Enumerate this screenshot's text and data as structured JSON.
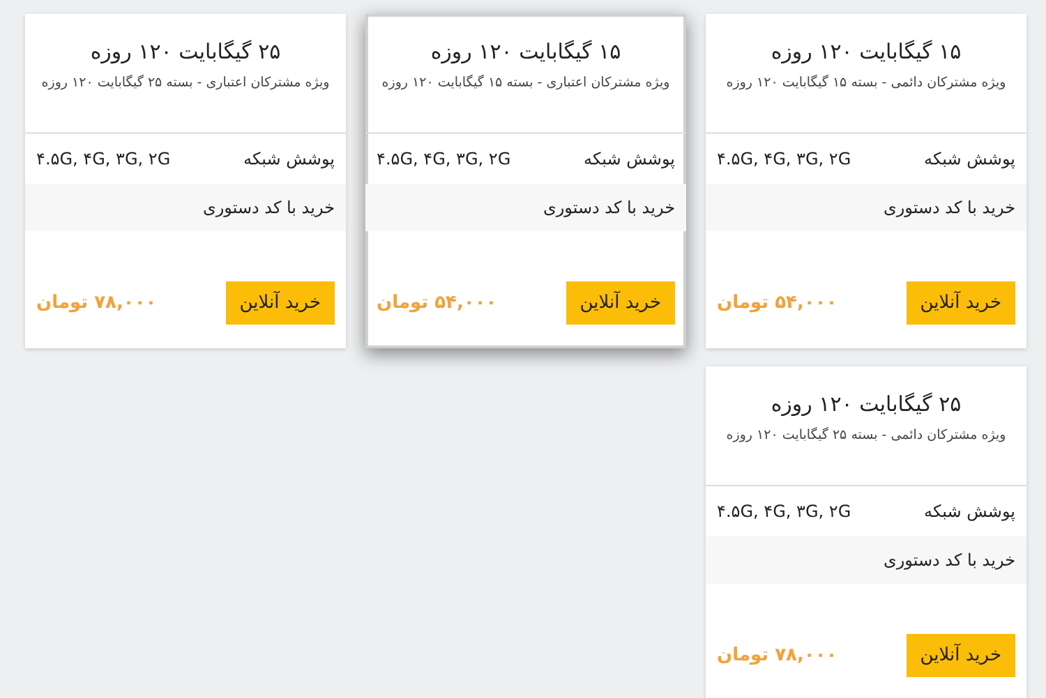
{
  "cards": [
    {
      "title": "۱۵ گیگابایت ۱۲۰ روزه",
      "subtitle": "ویژه مشترکان دائمی - بسته ۱۵ گیگابایت ۱۲۰ روزه",
      "coverage_label": "پوشش شبکه",
      "coverage": "۴.۵G, ۴G, ۳G, ۲G",
      "ussd": "خرید با کد دستوری",
      "button": "خرید آنلاین",
      "price": "۵۴,۰۰۰ تومان",
      "highlighted": false
    },
    {
      "title": "۱۵ گیگابایت ۱۲۰ روزه",
      "subtitle": "ویژه مشترکان اعتباری - بسته ۱۵ گیگابایت ۱۲۰ روزه",
      "coverage_label": "پوشش شبکه",
      "coverage": "۴.۵G, ۴G, ۳G, ۲G",
      "ussd": "خرید با کد دستوری",
      "button": "خرید آنلاین",
      "price": "۵۴,۰۰۰ تومان",
      "highlighted": true
    },
    {
      "title": "۲۵ گیگابایت ۱۲۰ روزه",
      "subtitle": "ویژه مشترکان اعتباری - بسته ۲۵ گیگابایت ۱۲۰ روزه",
      "coverage_label": "پوشش شبکه",
      "coverage": "۴.۵G, ۴G, ۳G, ۲G",
      "ussd": "خرید با کد دستوری",
      "button": "خرید آنلاین",
      "price": "۷۸,۰۰۰ تومان",
      "highlighted": false
    },
    {
      "title": "۲۵ گیگابایت ۱۲۰ روزه",
      "subtitle": "ویژه مشترکان دائمی - بسته ۲۵ گیگابایت ۱۲۰ روزه",
      "coverage_label": "پوشش شبکه",
      "coverage": "۴.۵G, ۴G, ۳G, ۲G",
      "ussd": "خرید با کد دستوری",
      "button": "خرید آنلاین",
      "price": "۷۸,۰۰۰ تومان",
      "highlighted": false
    }
  ]
}
